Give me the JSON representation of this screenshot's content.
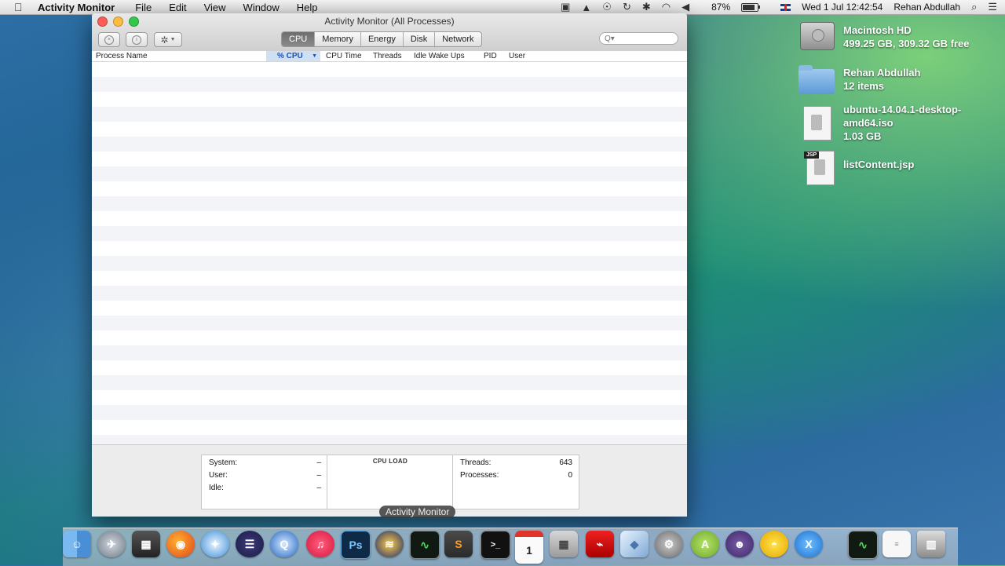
{
  "menubar": {
    "apple": "",
    "app_name": "Activity Monitor",
    "items": [
      "File",
      "Edit",
      "View",
      "Window",
      "Help"
    ],
    "battery": "87%",
    "datetime": "Wed 1 Jul  12:42:54",
    "user": "Rehan Abdullah"
  },
  "window": {
    "title": "Activity Monitor (All Processes)",
    "tabs": [
      "CPU",
      "Memory",
      "Energy",
      "Disk",
      "Network"
    ],
    "active_tab": "CPU",
    "search_placeholder": "Q▾",
    "columns": [
      "Process Name",
      "% CPU",
      "CPU Time",
      "Threads",
      "Idle Wake Ups",
      "PID",
      "User"
    ],
    "sorted_column": "% CPU"
  },
  "footer": {
    "system_label": "System:",
    "system_value": "–",
    "user_label": "User:",
    "user_value": "–",
    "idle_label": "Idle:",
    "idle_value": "–",
    "cpu_load_label": "CPU LOAD",
    "threads_label": "Threads:",
    "threads_value": "643",
    "processes_label": "Processes:",
    "processes_value": "0"
  },
  "tooltip": "Activity Monitor",
  "desktop": [
    {
      "title": "Macintosh HD",
      "sub": "499.25 GB, 309.32 GB free",
      "icon": "hard-drive-icon"
    },
    {
      "title": "Rehan Abdullah",
      "sub": "12 items",
      "icon": "folder-icon"
    },
    {
      "title": "ubuntu-14.04.1-desktop-",
      "title2": "amd64.iso",
      "sub": "1.03 GB",
      "icon": "disk-image-icon"
    },
    {
      "title": "listContent.jsp",
      "sub": "",
      "icon": "jsp-file-icon",
      "tag": "JSP"
    }
  ],
  "dock": {
    "items": [
      "finder",
      "launchpad",
      "image-capture",
      "firefox",
      "safari",
      "eclipse",
      "quicktime",
      "itunes",
      "photoshop",
      "audition",
      "activity-monitor",
      "sublime",
      "terminal",
      "calendar",
      "calculator",
      "acrobat",
      "cube",
      "system-preferences",
      "android-studio",
      "github",
      "cyberduck",
      "xcode",
      "console",
      "text-file",
      "trash"
    ],
    "labels": {
      "photoshop": "Ps",
      "xcode": "X",
      "calendar": "1",
      "sublime": "S"
    }
  }
}
